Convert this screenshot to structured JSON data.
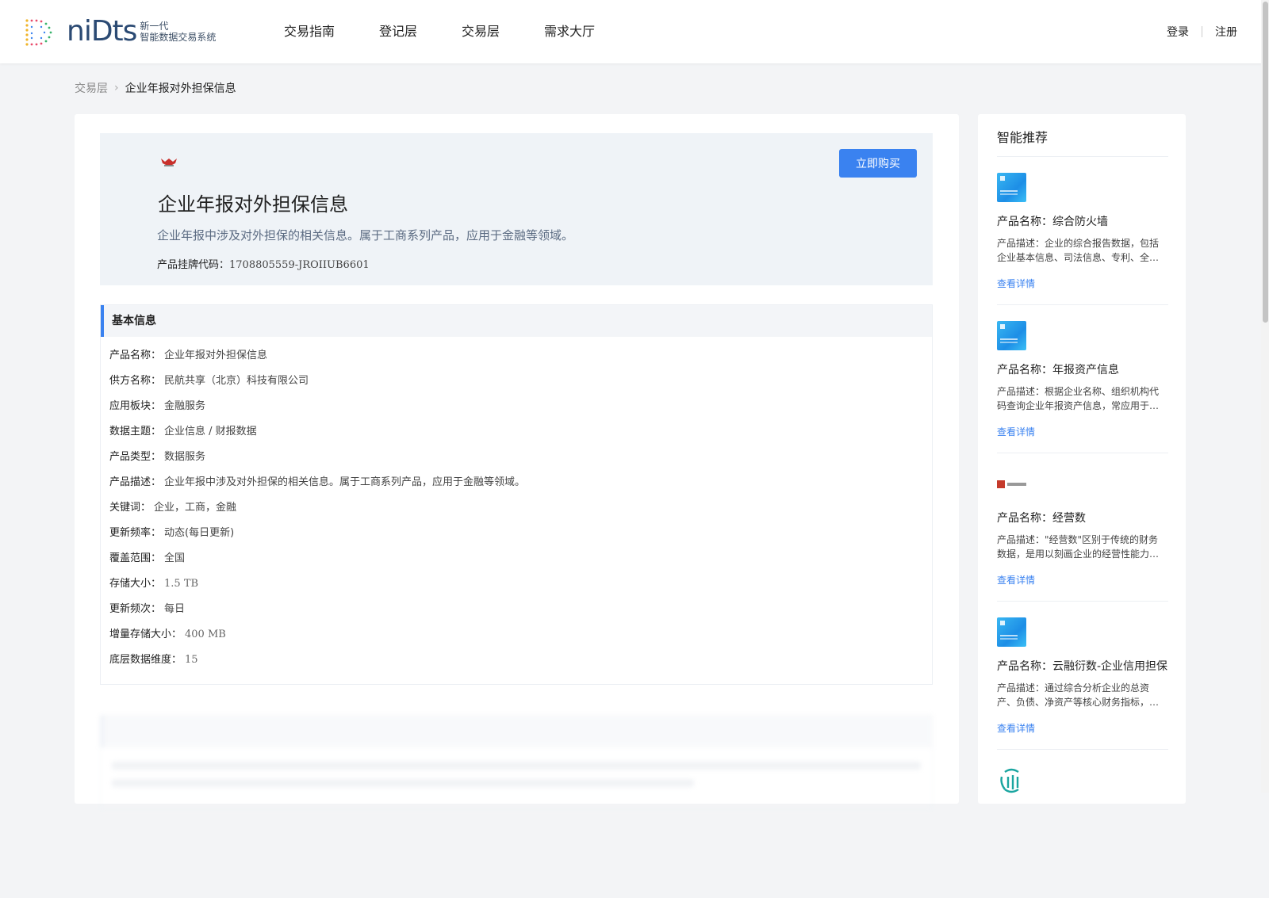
{
  "header": {
    "logo_word": "niDts",
    "logo_tag_1": "新一代",
    "logo_tag_2": "智能数据交易系统",
    "nav": [
      "交易指南",
      "登记层",
      "交易层",
      "需求大厅"
    ],
    "login": "登录",
    "register": "注册"
  },
  "breadcrumb": {
    "parent": "交易层",
    "current": "企业年报对外担保信息"
  },
  "product": {
    "title": "企业年报对外担保信息",
    "description": "企业年报中涉及对外担保的相关信息。属于工商系列产品，应用于金融等领域。",
    "code_label": "产品挂牌代码：",
    "code_value": "1708805559-JROIIUB6601",
    "buy_label": "立即购买"
  },
  "basic_info": {
    "heading": "基本信息",
    "rows": [
      {
        "key": "产品名称：",
        "value": "企业年报对外担保信息"
      },
      {
        "key": "供方名称：",
        "value": "民航共享（北京）科技有限公司"
      },
      {
        "key": "应用板块：",
        "value": "金融服务"
      },
      {
        "key": "数据主题：",
        "value": "企业信息 / 财报数据"
      },
      {
        "key": "产品类型：",
        "value": "数据服务"
      },
      {
        "key": "产品描述：",
        "value": "企业年报中涉及对外担保的相关信息。属于工商系列产品，应用于金融等领域。"
      },
      {
        "key": "关键词：",
        "value": "企业，工商，金融"
      },
      {
        "key": "更新频率：",
        "value": "动态(每日更新)"
      },
      {
        "key": "覆盖范围：",
        "value": "全国"
      },
      {
        "key": "存储大小：",
        "value": "1.5 TB"
      },
      {
        "key": "更新频次：",
        "value": "每日"
      },
      {
        "key": "增量存储大小：",
        "value": "400 MB"
      },
      {
        "key": "底层数据维度：",
        "value": "15"
      }
    ]
  },
  "sidebar": {
    "title": "智能推荐",
    "items": [
      {
        "name": "产品名称：综合防火墙",
        "desc": "产品描述：企业的综合报告数据，包括企业基本信息、司法信息、专利、全部等信息。",
        "link": "查看详情"
      },
      {
        "name": "产品名称：年报资产信息",
        "desc": "产品描述：根据企业名称、组织机构代码查询企业年报资产信息，常应用于金融风控等场景。",
        "link": "查看详情"
      },
      {
        "name": "产品名称：经营数",
        "desc": "产品描述：\"经营数\"区别于传统的财务数据，是用以刻画企业的经营性能力的数据。",
        "link": "查看详情"
      },
      {
        "name": "产品名称：云融衍数-企业信用担保",
        "desc": "产品描述：通过综合分析企业的总资产、负债、净资产等核心财务指标，评估企业信用。",
        "link": "查看详情"
      }
    ]
  }
}
